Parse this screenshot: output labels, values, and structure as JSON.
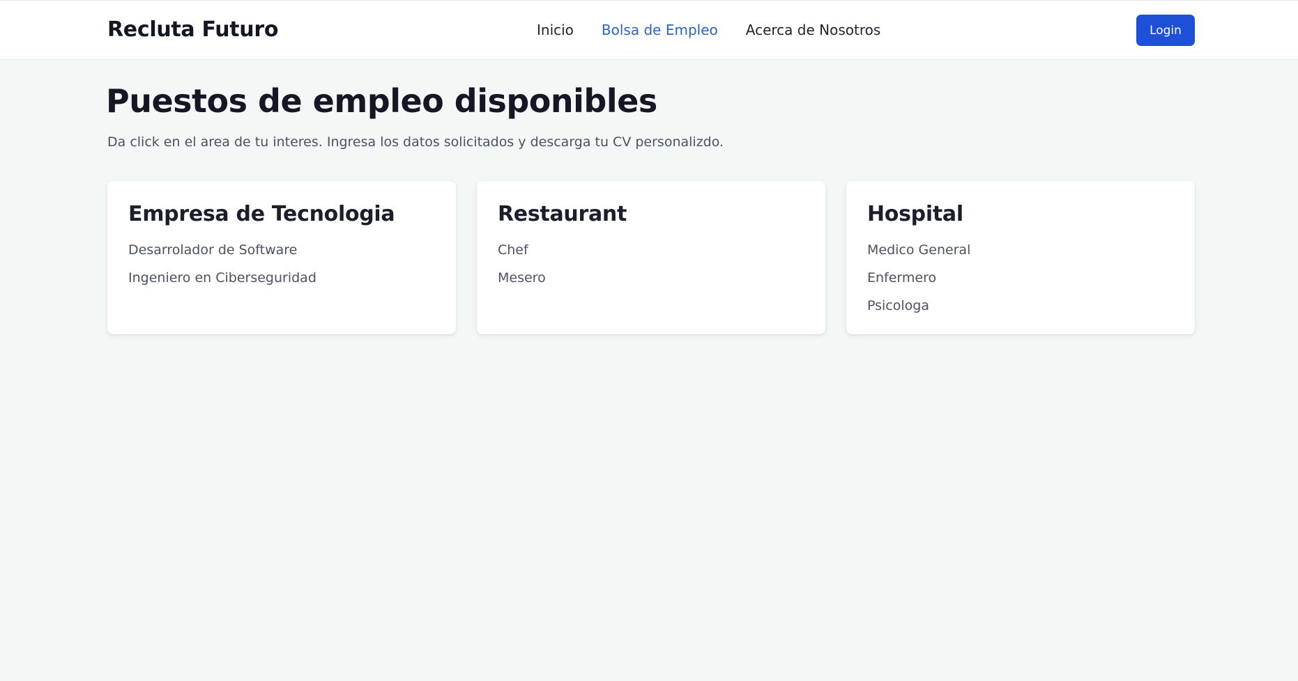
{
  "header": {
    "brand": "Recluta Futuro",
    "nav": [
      {
        "label": "Inicio",
        "active": false
      },
      {
        "label": "Bolsa de Empleo",
        "active": true
      },
      {
        "label": "Acerca de Nosotros",
        "active": false
      }
    ],
    "login_label": "Login"
  },
  "main": {
    "title": "Puestos de empleo disponibles",
    "subtitle": "Da click en el area de tu interes. Ingresa los datos solicitados y descarga tu CV personalizdo.",
    "cards": [
      {
        "title": "Empresa de Tecnologia",
        "jobs": [
          "Desarrolador de Software",
          "Ingeniero en Ciberseguridad"
        ]
      },
      {
        "title": "Restaurant",
        "jobs": [
          "Chef",
          "Mesero"
        ]
      },
      {
        "title": "Hospital",
        "jobs": [
          "Medico General",
          "Enfermero",
          "Psicologa"
        ]
      }
    ]
  },
  "colors": {
    "accent": "#1d4fd8",
    "active_link": "#2e63c4",
    "background": "#f3f7f6"
  }
}
